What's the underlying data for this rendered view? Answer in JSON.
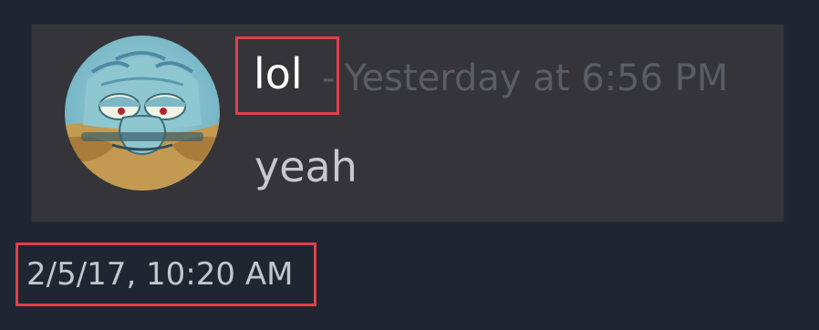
{
  "message": {
    "author": "lol",
    "separator": "-",
    "timestamp": "Yesterday at 6:56 PM",
    "text": "yeah"
  },
  "screenshot_timestamp": "2/5/17, 10:20 AM",
  "colors": {
    "background": "#1f2631",
    "card": "#353539",
    "author": "#ffffff",
    "meta": "#5a5d64",
    "message": "#c8c8cc",
    "highlight": "#e0404c"
  },
  "icons": {
    "avatar": "squidward-avatar"
  }
}
